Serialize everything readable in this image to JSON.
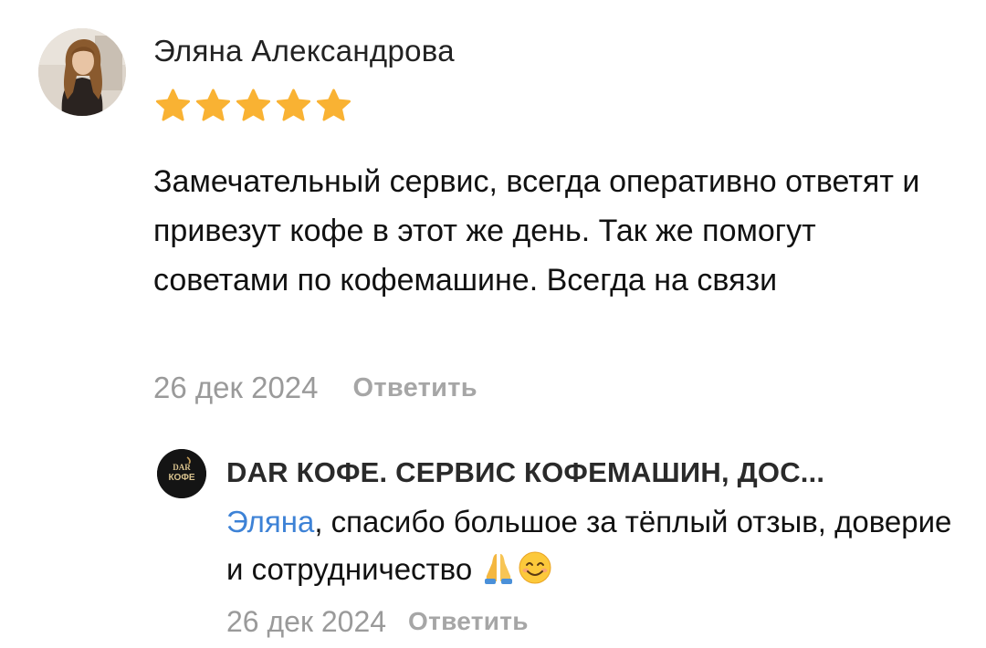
{
  "review": {
    "author": "Эляна Александрова",
    "rating": 5,
    "rating_max": 5,
    "star_color": "#f9b233",
    "text": "Замечательный сервис, всегда оперативно ответят и привезут кофе в этот же день. Так же помогут советами по кофемашине. Всегда на связи",
    "date": "26 дек 2024",
    "reply_label": "Ответить"
  },
  "reply": {
    "company_name": "DAR КОФЕ. СЕРВИС КОФЕМАШИН, ДОС...",
    "company_logo_text": "DAR КОФЕ",
    "mention": "Эляна",
    "text": ", спасибо большое за тёплый отзыв, доверие и сотрудничество ",
    "emojis": [
      "folded-hands-icon",
      "smiling-face-icon"
    ],
    "date": "26 дек 2024",
    "reply_label": "Ответить",
    "mention_color": "#3d82d6"
  }
}
